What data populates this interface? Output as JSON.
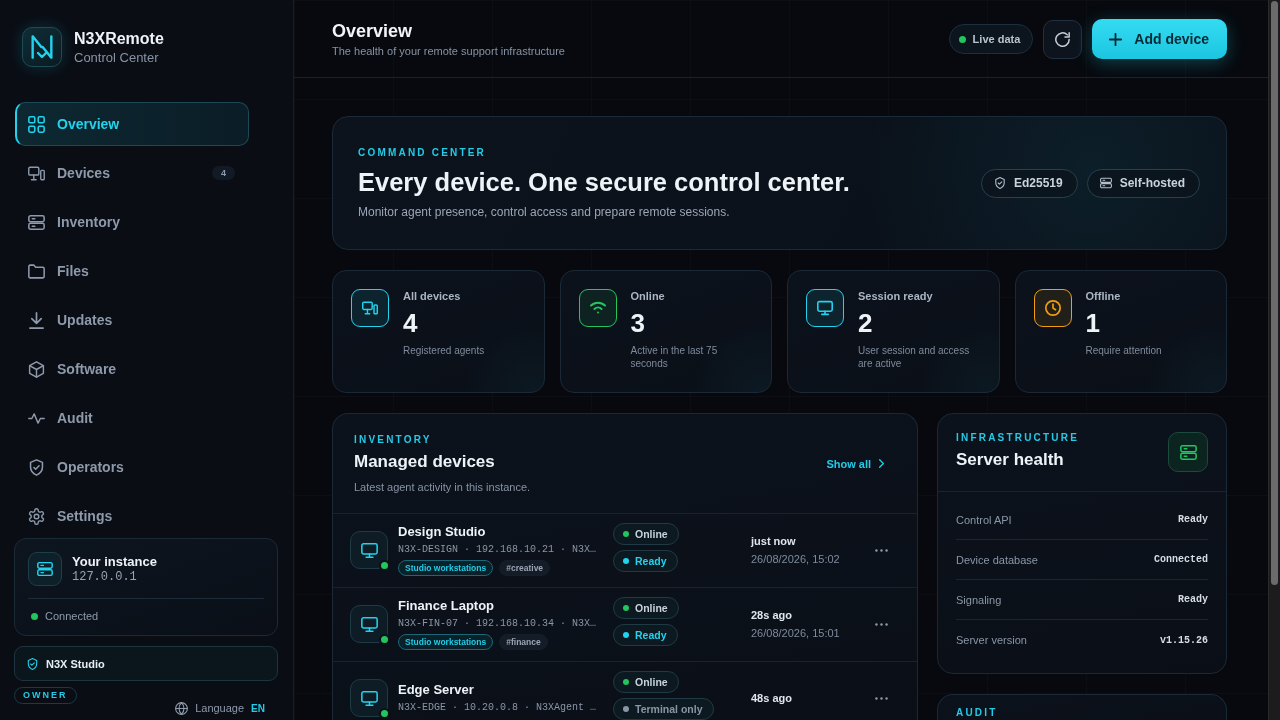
{
  "sidebar": {
    "brand": {
      "name": "N3XRemote",
      "subtitle": "Control Center"
    },
    "items": [
      {
        "label": "Overview",
        "selected": true
      },
      {
        "label": "Devices",
        "selected": false,
        "badge": "4"
      },
      {
        "label": "Inventory",
        "selected": false
      },
      {
        "label": "Files",
        "selected": false
      },
      {
        "label": "Updates",
        "selected": false
      },
      {
        "label": "Software",
        "selected": false
      },
      {
        "label": "Audit",
        "selected": false
      },
      {
        "label": "Operators",
        "selected": false
      },
      {
        "label": "Settings",
        "selected": false
      }
    ],
    "instance": {
      "title": "Your instance",
      "address": "127.0.0.1",
      "status": "Connected",
      "connected": true
    },
    "workspace": {
      "name": "N3X Studio",
      "role": "OWNER"
    },
    "language": {
      "label": "Language",
      "code": "EN"
    }
  },
  "header": {
    "title": "Overview",
    "subtitle": "The health of your remote support infrastructure",
    "live": {
      "label": "Live data",
      "on": true
    },
    "add_button": "Add device"
  },
  "hero": {
    "eyebrow": "COMMAND CENTER",
    "title": "Every device. One secure control center.",
    "subtitle": "Monitor agent presence, control access and prepare remote sessions.",
    "badges": [
      "Ed25519",
      "Self-hosted"
    ]
  },
  "stats": [
    {
      "label": "All devices",
      "value": "4",
      "caption": "Registered agents",
      "color": "#22d3ee"
    },
    {
      "label": "Online",
      "value": "3",
      "caption": "Active in the last 75 seconds",
      "color": "#22c55e"
    },
    {
      "label": "Session ready",
      "value": "2",
      "caption": "User session and access are active",
      "color": "#22d3ee"
    },
    {
      "label": "Offline",
      "value": "1",
      "caption": "Require attention",
      "color": "#f59e0b"
    }
  ],
  "devices": {
    "eyebrow": "INVENTORY",
    "title": "Managed devices",
    "subtitle": "Latest agent activity in this instance.",
    "link": "Show all",
    "rows": [
      {
        "name": "Design Studio",
        "meta": "N3X-DESIGN · 192.168.10.21 · N3X…",
        "online": true,
        "tags": [
          {
            "label": "Studio workstations",
            "kind": "group"
          },
          {
            "label": "#creative",
            "kind": "tag"
          }
        ],
        "statuses": [
          {
            "label": "Online",
            "kind": "presence",
            "color": "#22c55e"
          },
          {
            "label": "Ready",
            "kind": "session",
            "color": "#22d3ee"
          }
        ],
        "last_seen": "just now",
        "timestamp": "26/08/2026, 15:02"
      },
      {
        "name": "Finance Laptop",
        "meta": "N3X-FIN-07 · 192.168.10.34 · N3X…",
        "online": true,
        "tags": [
          {
            "label": "Studio workstations",
            "kind": "group"
          },
          {
            "label": "#finance",
            "kind": "tag"
          }
        ],
        "statuses": [
          {
            "label": "Online",
            "kind": "presence",
            "color": "#22c55e"
          },
          {
            "label": "Ready",
            "kind": "session",
            "color": "#22d3ee"
          }
        ],
        "last_seen": "28s ago",
        "timestamp": "26/08/2026, 15:01"
      },
      {
        "name": "Edge Server",
        "meta": "N3X-EDGE · 10.20.0.8 · N3XAgent …",
        "online": true,
        "statuses": [
          {
            "label": "Online",
            "kind": "presence",
            "color": "#22c55e"
          },
          {
            "label": "Terminal only",
            "kind": "session",
            "color": "#8b95a5"
          }
        ],
        "last_seen": "48s ago"
      }
    ]
  },
  "health": {
    "eyebrow": "INFRASTRUCTURE",
    "title": "Server health",
    "rows": [
      {
        "label": "Control API",
        "value": "Ready"
      },
      {
        "label": "Device database",
        "value": "Connected"
      },
      {
        "label": "Signaling",
        "value": "Ready"
      },
      {
        "label": "Server version",
        "value": "v1.15.26"
      }
    ]
  },
  "audit": {
    "eyebrow": "AUDIT"
  }
}
